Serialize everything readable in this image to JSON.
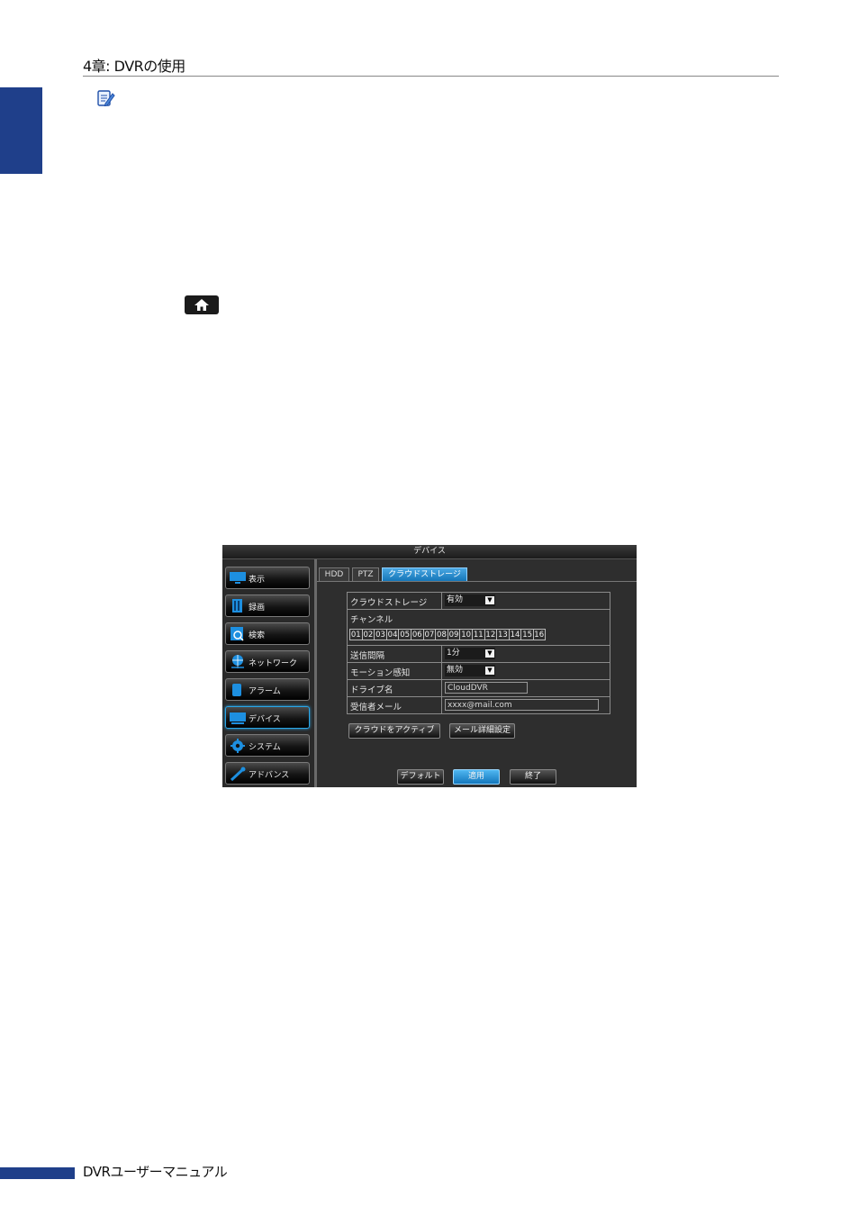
{
  "page": {
    "chapter_title": "4章: DVRの使用",
    "footer_text": "DVRユーザーマニュアル",
    "note_icon": "note-pencil-icon",
    "home_icon": "home-icon"
  },
  "dvr": {
    "window_title": "デバイス",
    "menu": [
      {
        "label": "表示",
        "icon": "monitor-icon"
      },
      {
        "label": "録画",
        "icon": "film-icon"
      },
      {
        "label": "検索",
        "icon": "magnifier-icon"
      },
      {
        "label": "ネットワーク",
        "icon": "globe-icon"
      },
      {
        "label": "アラーム",
        "icon": "alarm-icon"
      },
      {
        "label": "デバイス",
        "icon": "device-icon"
      },
      {
        "label": "システム",
        "icon": "gear-icon"
      },
      {
        "label": "アドバンス",
        "icon": "wrench-icon"
      }
    ],
    "tabs": [
      "HDD",
      "PTZ",
      "クラウドストレージ"
    ],
    "form": {
      "cloud_storage_label": "クラウドストレージ",
      "cloud_storage_value": "有効",
      "channel_label": "チャンネル",
      "channels": [
        "01",
        "02",
        "03",
        "04",
        "05",
        "06",
        "07",
        "08",
        "09",
        "10",
        "11",
        "12",
        "13",
        "14",
        "15",
        "16"
      ],
      "send_interval_label": "送信間隔",
      "send_interval_value": "1分",
      "motion_label": "モーション感知",
      "motion_value": "無効",
      "drive_name_label": "ドライブ名",
      "drive_name_value": "CloudDVR",
      "recipient_label": "受信者メール",
      "recipient_value": "xxxx@mail.com"
    },
    "buttons": {
      "activate_cloud": "クラウドをアクティブ",
      "mail_settings": "メール詳細設定",
      "default": "デフォルト",
      "apply": "適用",
      "exit": "終了"
    }
  }
}
